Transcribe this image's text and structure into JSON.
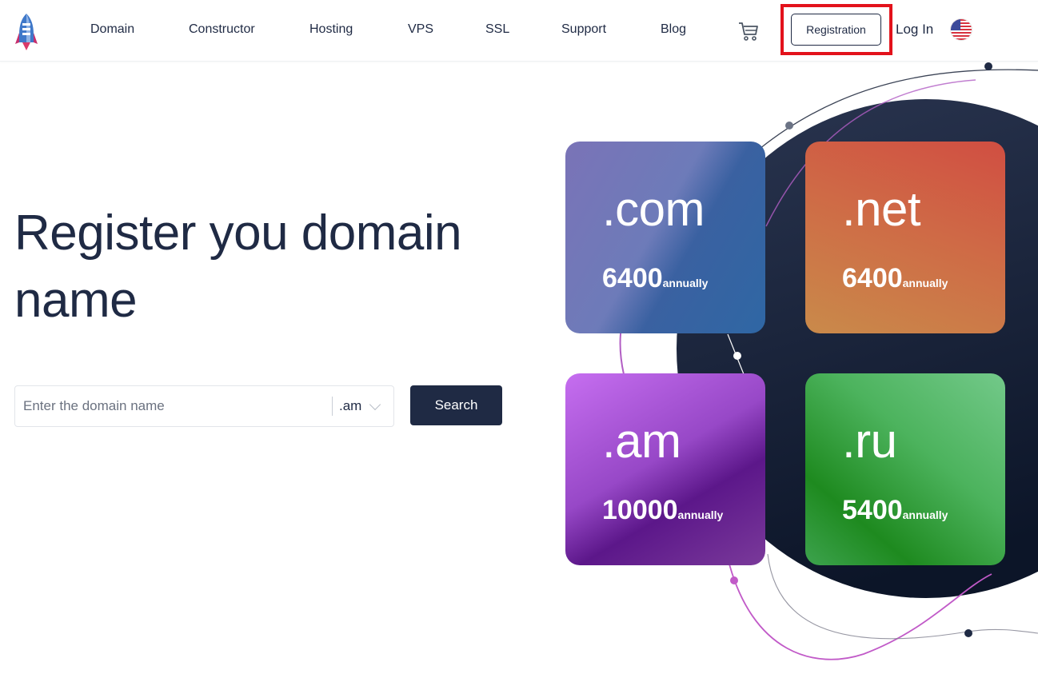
{
  "header": {
    "nav": [
      "Domain",
      "Constructor",
      "Hosting",
      "VPS",
      "SSL",
      "Support",
      "Blog"
    ],
    "registration_label": "Registration",
    "login_label": "Log In"
  },
  "hero": {
    "title": "Register you domain name"
  },
  "search": {
    "placeholder": "Enter the domain name",
    "tld_selected": ".am",
    "button_label": "Search"
  },
  "cards": [
    {
      "tld": ".com",
      "price": "6400",
      "period": "annually"
    },
    {
      "tld": ".net",
      "price": "6400",
      "period": "annually"
    },
    {
      "tld": ".am",
      "price": "10000",
      "period": "annually"
    },
    {
      "tld": ".ru",
      "price": "5400",
      "period": "annually"
    }
  ],
  "colors": {
    "primary": "#1f2a44",
    "highlight": "#e3121b"
  },
  "icons": [
    "rocket-logo-icon",
    "cart-icon",
    "us-flag-icon",
    "chevron-down-icon"
  ]
}
